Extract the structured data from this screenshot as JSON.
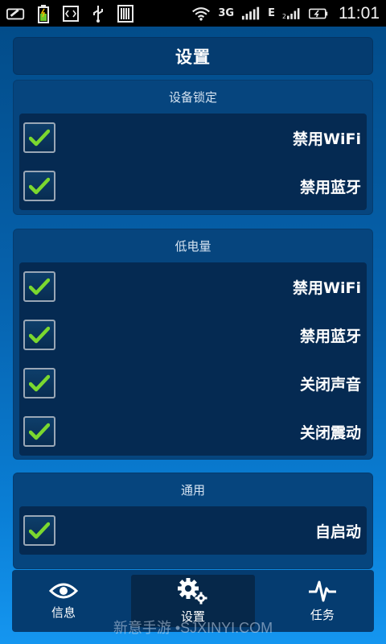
{
  "status_bar": {
    "network_type": "E",
    "data_3g": "3G",
    "time": "11:01",
    "icons": [
      "card-icon",
      "battery-charging-icon",
      "code-icon",
      "usb-icon",
      "barcode-icon",
      "wifi-icon",
      "signal-icon",
      "battery-icon"
    ]
  },
  "header": {
    "title": "设置"
  },
  "sections": [
    {
      "title": "设备锁定",
      "items": [
        {
          "label": "禁用WiFi",
          "checked": true
        },
        {
          "label": "禁用蓝牙",
          "checked": true
        }
      ]
    },
    {
      "title": "低电量",
      "items": [
        {
          "label": "禁用WiFi",
          "checked": true
        },
        {
          "label": "禁用蓝牙",
          "checked": true
        },
        {
          "label": "关闭声音",
          "checked": true
        },
        {
          "label": "关闭震动",
          "checked": true
        }
      ]
    },
    {
      "title": "通用",
      "items": [
        {
          "label": "自启动",
          "checked": true
        }
      ]
    }
  ],
  "bottom_nav": [
    {
      "label": "信息",
      "icon": "eye-icon"
    },
    {
      "label": "设置",
      "icon": "gears-icon",
      "active": true
    },
    {
      "label": "任务",
      "icon": "pulse-icon"
    }
  ],
  "watermark": "新意手游 •SJXINYI.COM",
  "colors": {
    "check": "#7bd82f",
    "panel": "#06457e",
    "row_bg": "#052a52"
  }
}
